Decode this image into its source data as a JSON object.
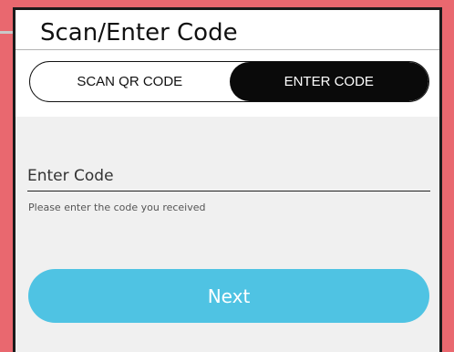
{
  "screen": {
    "title": "Scan/Enter Code"
  },
  "tabs": [
    {
      "label": "SCAN QR CODE",
      "active": false
    },
    {
      "label": "ENTER CODE",
      "active": true
    }
  ],
  "code_input": {
    "placeholder": "Enter Code",
    "value": ""
  },
  "helper_text": "Please enter the code you received",
  "next_button": {
    "label": "Next"
  },
  "colors": {
    "background": "#e9686f",
    "accent": "#4fc3e3",
    "active_tab": "#0a0a0a",
    "panel": "#f0f0f0"
  }
}
